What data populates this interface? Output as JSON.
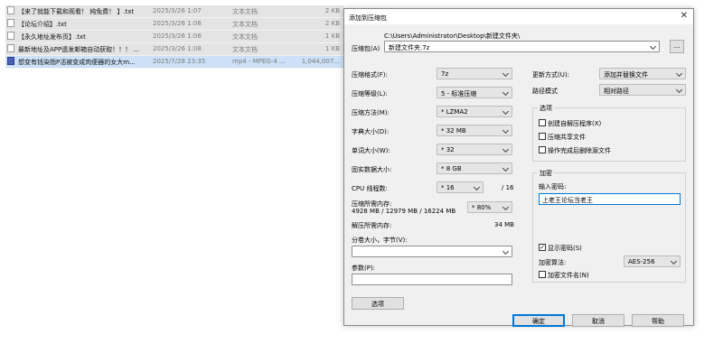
{
  "files": [
    {
      "name": "【来了就能下载和观看！ 纯免费！ 】.txt",
      "date": "2025/3/26 1:07",
      "type": "文本文档",
      "size": "2 KB",
      "icon": "text-file-icon",
      "highlight": false
    },
    {
      "name": "【论坛介绍】.txt",
      "date": "2025/3/26 1:08",
      "type": "文本文档",
      "size": "2 KB",
      "icon": "text-file-icon",
      "highlight": false
    },
    {
      "name": "【永久地址发布页】.txt",
      "date": "2025/3/26 1:08",
      "type": "文本文档",
      "size": "1 KB",
      "icon": "text-file-icon",
      "highlight": false
    },
    {
      "name": "最新地址及APP遗发邮箱自动获取！！！ ...",
      "date": "2025/3/26 1:08",
      "type": "文本文档",
      "size": "1 KB",
      "icon": "text-file-icon",
      "highlight": false
    },
    {
      "name": "想变有钱染指P活被变成肉便器的女大m...",
      "date": "2025/7/28 23:35",
      "type": "mp4 - MPEG-4 ...",
      "size": "1,044,007...",
      "icon": "media-file-icon",
      "highlight": true
    }
  ],
  "dialog": {
    "title": "添加到压缩包",
    "archive": {
      "label": "压缩包(A)",
      "path": "C:\\Users\\Administrator\\Desktop\\新建文件夹\\",
      "name": "新建文件夹.7z",
      "browse_label": "..."
    },
    "left_fields": [
      {
        "label": "压缩格式(F):",
        "value": "7z"
      },
      {
        "label": "压缩等级(L):",
        "value": "5 - 标准压缩"
      },
      {
        "label": "压缩方法(M):",
        "value": "* LZMA2"
      },
      {
        "label": "字典大小(D):",
        "value": "* 32 MB"
      },
      {
        "label": "单词大小(W):",
        "value": "* 32"
      },
      {
        "label": "固实数据大小:",
        "value": "* 8 GB"
      }
    ],
    "cpu": {
      "label": "CPU 线程数:",
      "value": "* 16",
      "total": "/ 16"
    },
    "memory": {
      "label": "压缩所需内存:",
      "values": "4928 MB / 12979 MB / 16224 MB",
      "percent": "* 80%",
      "decompress_label": "解压所需内存:",
      "decompress_value": "34 MB"
    },
    "volume": {
      "label": "分卷大小，字节(V):",
      "value": ""
    },
    "params": {
      "label": "参数(P):",
      "value": ""
    },
    "options_button": "选项",
    "update_mode": {
      "label": "更新方式(U):",
      "value": "添加并替换文件"
    },
    "path_mode": {
      "label": "路径模式",
      "value": "相对路径"
    },
    "options_group": {
      "title": "选项",
      "items": [
        {
          "label": "创建自解压程序(X)",
          "checked": false
        },
        {
          "label": "压缩共享文件",
          "checked": false
        },
        {
          "label": "操作完成后删除源文件",
          "checked": false
        }
      ]
    },
    "encryption": {
      "title": "加密",
      "password_label": "输入密码:",
      "password_value": "上老王论坛当老王",
      "show_password": {
        "label": "显示密码(S)",
        "checked": true
      },
      "method_label": "加密算法:",
      "method_value": "AES-256",
      "encrypt_names": {
        "label": "加密文件名(N)",
        "checked": false
      }
    },
    "buttons": {
      "ok": "确定",
      "cancel": "取消",
      "help": "帮助"
    },
    "check_mark": "✓",
    "close_glyph": "✕",
    "accent_color": "#0078d7"
  }
}
